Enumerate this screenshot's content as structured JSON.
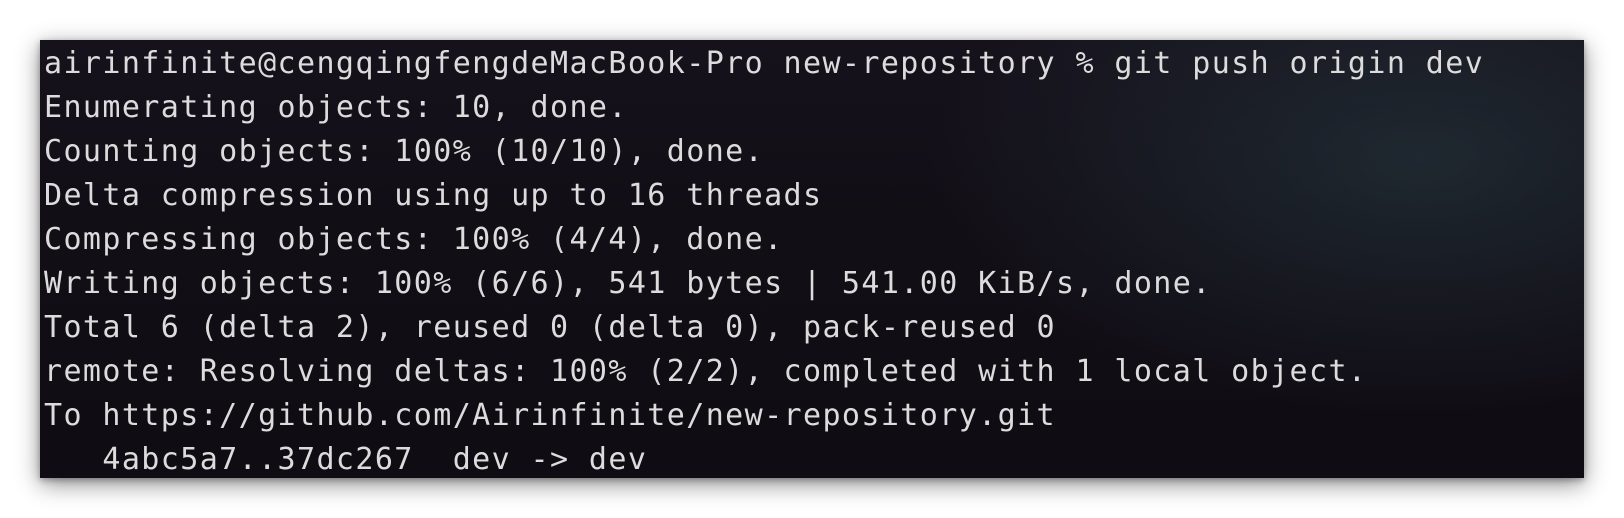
{
  "terminal": {
    "lines": [
      "airinfinite@cengqingfengdeMacBook-Pro new-repository % git push origin dev",
      "Enumerating objects: 10, done.",
      "Counting objects: 100% (10/10), done.",
      "Delta compression using up to 16 threads",
      "Compressing objects: 100% (4/4), done.",
      "Writing objects: 100% (6/6), 541 bytes | 541.00 KiB/s, done.",
      "Total 6 (delta 2), reused 0 (delta 0), pack-reused 0",
      "remote: Resolving deltas: 100% (2/2), completed with 1 local object.",
      "To https://github.com/Airinfinite/new-repository.git",
      "   4abc5a7..37dc267  dev -> dev"
    ]
  },
  "colors": {
    "background": "#120e16",
    "text": "#dcdcdc"
  }
}
